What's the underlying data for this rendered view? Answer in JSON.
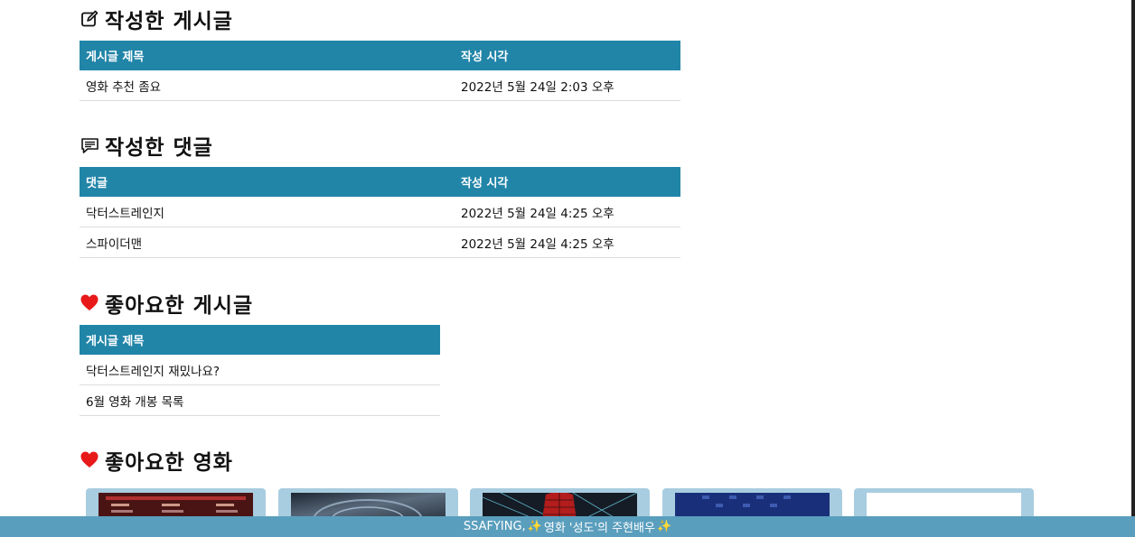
{
  "written_posts": {
    "title": "작성한 게시글",
    "icon": "pencil-square-icon",
    "columns": [
      "게시글 제목",
      "작성 시각"
    ],
    "rows": [
      {
        "title": "영화 추천 좀요",
        "time": "2022년 5월 24일 2:03 오후"
      }
    ]
  },
  "written_comments": {
    "title": "작성한 댓글",
    "icon": "chat-lines-icon",
    "columns": [
      "댓글",
      "작성 시각"
    ],
    "rows": [
      {
        "comment": "닥터스트레인지",
        "time": "2022년 5월 24일 4:25 오후"
      },
      {
        "comment": "스파이더맨",
        "time": "2022년 5월 24일 4:25 오후"
      }
    ]
  },
  "liked_posts": {
    "title": "좋아요한 게시글",
    "icon": "heart-icon",
    "columns": [
      "게시글 제목"
    ],
    "rows": [
      {
        "title": "닥터스트레인지 재밌나요?"
      },
      {
        "title": "6월 영화 개봉 목록"
      }
    ]
  },
  "liked_movies": {
    "title": "좋아요한 영화",
    "icon": "heart-icon",
    "movies": [
      {
        "poster_color": "#5a1a1a"
      },
      {
        "poster_color": "#3a4a5a"
      },
      {
        "poster_color": "#2a2f3a"
      },
      {
        "poster_color": "#1f3a7a"
      },
      {
        "poster_color": "#ffffff"
      }
    ]
  },
  "footer": {
    "text_before": "SSAFYING, ",
    "text_main": "영화 '성도'의 주현배우",
    "icon": "sparkle-icon"
  },
  "colors": {
    "table_header": "#2185a8",
    "heart": "#e81919",
    "footer_bg": "#5a9ebd",
    "card_bg": "#a9cde0"
  }
}
